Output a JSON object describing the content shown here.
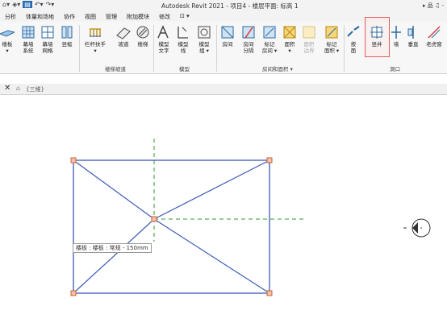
{
  "title": "Autodesk Revit 2021 - 项目4 - 楼层平面: 标高 1",
  "quick_access": [
    "home-icon",
    "open-icon",
    "save-icon",
    "undo-icon",
    "redo-icon"
  ],
  "title_right": "▸ 品 ♫ -",
  "tabs": [
    "分析",
    "体量和场地",
    "协作",
    "视图",
    "管理",
    "附加模块",
    "修改",
    "⊡ ▾"
  ],
  "ribbon": {
    "buttons": [
      {
        "label1": "楼板",
        "label2": "▾"
      },
      {
        "label1": "幕墙",
        "label2": "系统"
      },
      {
        "label1": "幕墙",
        "label2": "网格"
      },
      {
        "label1": "竖梃",
        "label2": ""
      },
      {
        "label1": "栏杆扶手",
        "label2": "▾"
      },
      {
        "label1": "坡道",
        "label2": ""
      },
      {
        "label1": "楼梯",
        "label2": ""
      },
      {
        "label1": "模型",
        "label2": "文字"
      },
      {
        "label1": "模型",
        "label2": "线"
      },
      {
        "label1": "模型",
        "label2": "组 ▾"
      },
      {
        "label1": "房间",
        "label2": ""
      },
      {
        "label1": "房间",
        "label2": "分隔"
      },
      {
        "label1": "标记",
        "label2": "房间 ▾"
      },
      {
        "label1": "面积",
        "label2": "▾"
      },
      {
        "label1": "面积",
        "label2": "边界"
      },
      {
        "label1": "标记",
        "label2": "面积 ▾"
      },
      {
        "label1": "按",
        "label2": "面"
      },
      {
        "label1": "竖井",
        "label2": ""
      },
      {
        "label1": "墙",
        "label2": ""
      },
      {
        "label1": "垂直",
        "label2": ""
      },
      {
        "label1": "老虎窗",
        "label2": ""
      }
    ],
    "panels": [
      "楼梯坡道",
      "模型",
      "房间和面积 ▾",
      "洞口"
    ]
  },
  "view_tab": {
    "label": "{三维}"
  },
  "tooltip": "楼板 : 楼板 : 常规 - 150mm"
}
